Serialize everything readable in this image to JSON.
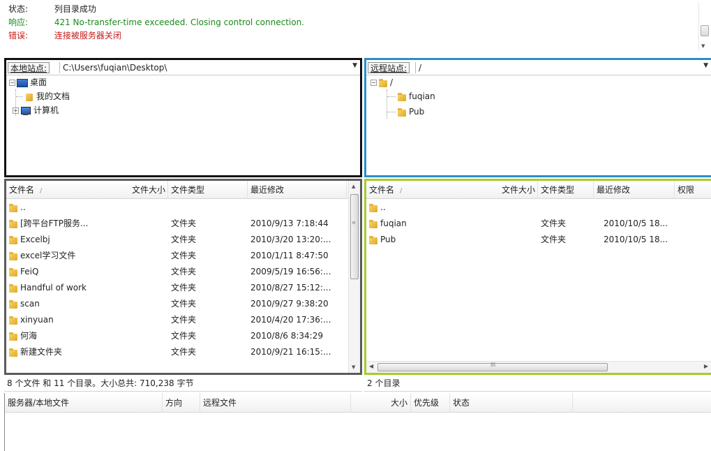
{
  "log": [
    {
      "label": "状态:",
      "text": "列目录成功",
      "color": "#222222"
    },
    {
      "label": "响应:",
      "text": "421 No-transfer-time exceeded. Closing control connection.",
      "color": "#1a8a1a"
    },
    {
      "label": "错误:",
      "text": "连接被服务器关闭",
      "color": "#c41a1a"
    }
  ],
  "local_site": {
    "label": "本地站点:",
    "path": "C:\\Users\\fuqian\\Desktop\\",
    "tree": {
      "root": {
        "toggle": "⊟",
        "label": "桌面",
        "icon": "desktop-icon"
      },
      "child1": {
        "label": "我的文档",
        "icon": "folder-icon"
      },
      "child2": {
        "toggle": "⊞",
        "label": "计算机",
        "icon": "computer-icon"
      }
    }
  },
  "remote_site": {
    "label": "远程站点:",
    "path": "/",
    "tree": {
      "root": {
        "toggle": "⊟",
        "label": "/",
        "icon": "folder-icon"
      },
      "child1": {
        "label": "fuqian",
        "icon": "folder-icon"
      },
      "child2": {
        "label": "Pub",
        "icon": "folder-icon"
      }
    }
  },
  "local_list": {
    "columns": {
      "name": "文件名",
      "sort": "/",
      "size": "文件大小",
      "type": "文件类型",
      "modified": "最近修改"
    },
    "rows": [
      {
        "name": "..",
        "type": "",
        "modified": ""
      },
      {
        "name": "[跨平台FTP服务...",
        "type": "文件夹",
        "modified": "2010/9/13 7:18:44"
      },
      {
        "name": "Excelbj",
        "type": "文件夹",
        "modified": "2010/3/20 13:20:..."
      },
      {
        "name": "excel学习文件",
        "type": "文件夹",
        "modified": "2010/1/11 8:47:50"
      },
      {
        "name": "FeiQ",
        "type": "文件夹",
        "modified": "2009/5/19 16:56:..."
      },
      {
        "name": "Handful of work",
        "type": "文件夹",
        "modified": "2010/8/27 15:12:..."
      },
      {
        "name": "scan",
        "type": "文件夹",
        "modified": "2010/9/27 9:38:20"
      },
      {
        "name": "xinyuan",
        "type": "文件夹",
        "modified": "2010/4/20 17:36:..."
      },
      {
        "name": "何海",
        "type": "文件夹",
        "modified": "2010/8/6 8:34:29"
      },
      {
        "name": "新建文件夹",
        "type": "文件夹",
        "modified": "2010/9/21 16:15:..."
      }
    ],
    "status": "8 个文件 和 11 个目录。大小总共: 710,238 字节"
  },
  "remote_list": {
    "columns": {
      "name": "文件名",
      "sort": "/",
      "size": "文件大小",
      "type": "文件类型",
      "modified": "最近修改",
      "perm": "权限"
    },
    "rows": [
      {
        "name": "..",
        "type": "",
        "modified": ""
      },
      {
        "name": "fuqian",
        "type": "文件夹",
        "modified": "2010/10/5 18..."
      },
      {
        "name": "Pub",
        "type": "文件夹",
        "modified": "2010/10/5 18..."
      }
    ],
    "status": "2 个目录",
    "hscroll_grip": "III"
  },
  "queue": {
    "columns": {
      "server_local": "服务器/本地文件",
      "direction": "方向",
      "remote": "远程文件",
      "size": "大小",
      "priority": "优先级",
      "status": "状态"
    }
  },
  "colors": {
    "local_site_border": "#111111",
    "remote_site_border": "#2a8ec9",
    "local_list_border": "#5b5b5b",
    "remote_list_border": "#a5cc2a",
    "status_ok": "#1a8a1a",
    "error": "#c41a1a"
  }
}
